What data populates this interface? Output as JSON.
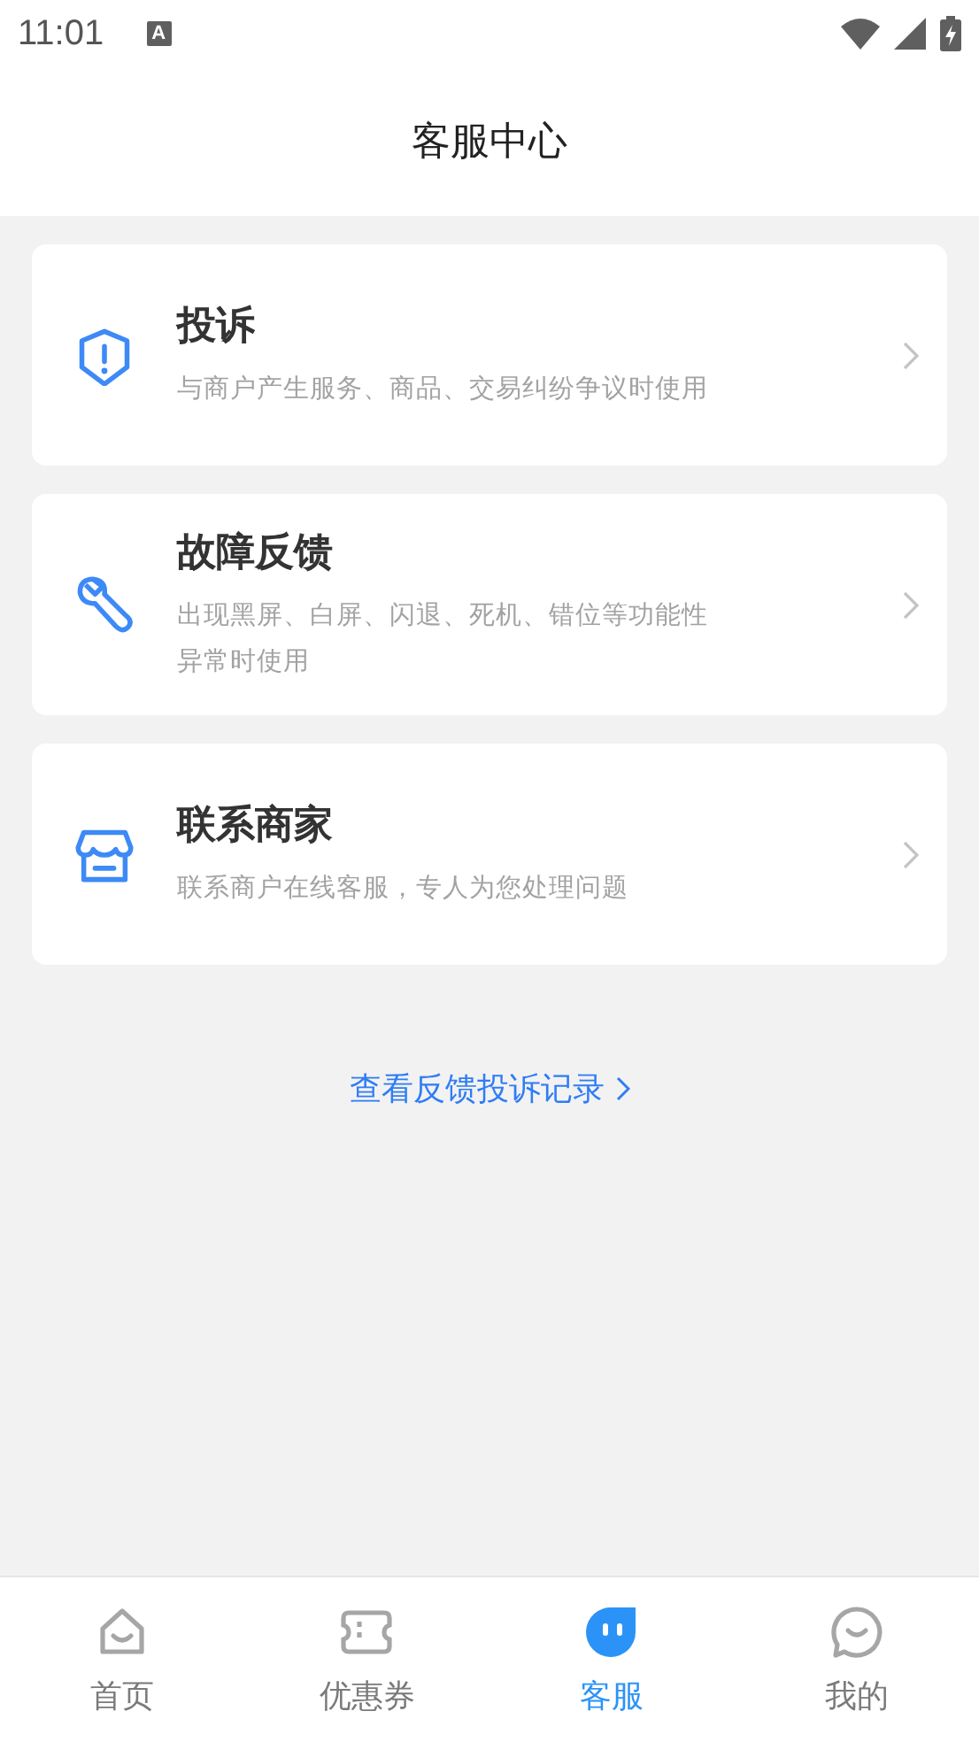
{
  "status_bar": {
    "time": "11:01",
    "notification": "A"
  },
  "header": {
    "title": "客服中心"
  },
  "cards": [
    {
      "kind": "shield",
      "title": "投诉",
      "description": "与商户产生服务、商品、交易纠纷争议时使用"
    },
    {
      "kind": "wrench",
      "title": "故障反馈",
      "description": "出现黑屏、白屏、闪退、死机、错位等功能性异常时使用"
    },
    {
      "kind": "store",
      "title": "联系商家",
      "description": "联系商户在线客服，专人为您处理问题"
    }
  ],
  "records_link": "查看反馈投诉记录",
  "tabs": [
    {
      "kind": "home",
      "label": "首页",
      "selected": false
    },
    {
      "kind": "ticket",
      "label": "优惠券",
      "selected": false
    },
    {
      "kind": "service",
      "label": "客服",
      "selected": true
    },
    {
      "kind": "chat",
      "label": "我的",
      "selected": false
    }
  ]
}
